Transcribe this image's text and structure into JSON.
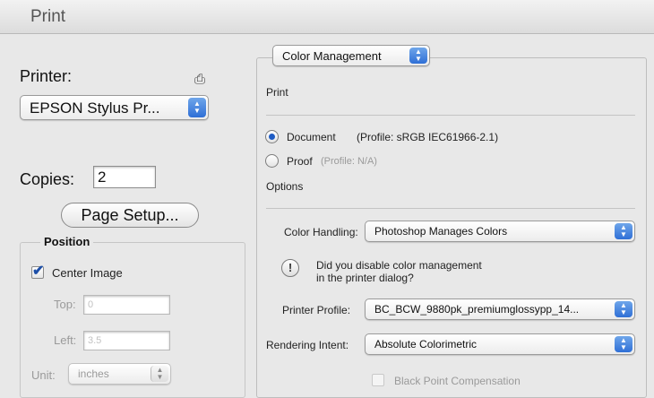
{
  "window": {
    "title": "Print"
  },
  "printer": {
    "label": "Printer:",
    "selected": "EPSON Stylus Pr..."
  },
  "copies": {
    "label": "Copies:",
    "value": "2"
  },
  "page_setup_label": "Page Setup...",
  "position": {
    "title": "Position",
    "center_image_label": "Center Image",
    "center_image_checked": true,
    "top_label": "Top:",
    "top_value": "0",
    "left_label": "Left:",
    "left_value": "3.5",
    "unit_label": "Unit:",
    "unit_value": "inches"
  },
  "color_management": {
    "section_menu": "Color Management",
    "print_label": "Print",
    "document_label": "Document",
    "document_profile": "(Profile: sRGB IEC61966-2.1)",
    "proof_label": "Proof",
    "proof_profile": "(Profile: N/A)",
    "selected_source": "Document",
    "options_label": "Options",
    "color_handling_label": "Color Handling:",
    "color_handling_value": "Photoshop Manages Colors",
    "warning_line1": "Did you disable color management",
    "warning_line2": "in the printer dialog?",
    "printer_profile_label": "Printer Profile:",
    "printer_profile_value": "BC_BCW_9880pk_premiumglossypp_14...",
    "rendering_intent_label": "Rendering Intent:",
    "rendering_intent_value": "Absolute Colorimetric",
    "black_point_label": "Black Point Compensation",
    "black_point_checked": false
  },
  "icons": {
    "printer": "printer-icon",
    "popup_arrows": "up-down-arrows-icon",
    "checkmark": "checkmark-icon",
    "warning": "exclamation-icon"
  },
  "colors": {
    "accent": "#2f6fd6",
    "background": "#e8e8e8"
  }
}
